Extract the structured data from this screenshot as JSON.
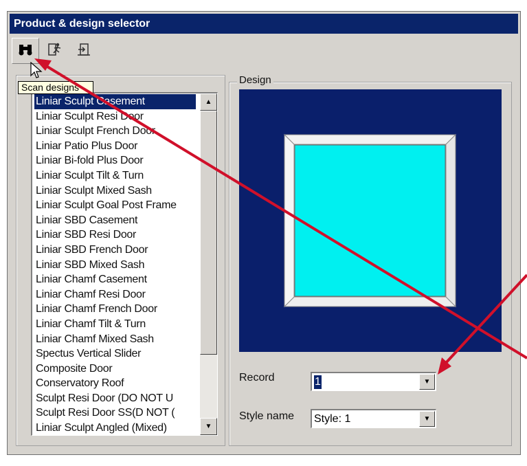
{
  "window": {
    "title": "Product & design selector"
  },
  "toolbar": {
    "buttons": [
      {
        "name": "scan-designs-button",
        "icon": "binoculars-icon"
      },
      {
        "name": "add-design-button",
        "icon": "running-figure-icon"
      },
      {
        "name": "exit-designs-button",
        "icon": "door-exit-icon"
      }
    ],
    "tooltip": "Scan designs"
  },
  "list": {
    "items": [
      "Liniar Sculpt Casement",
      "Liniar Sculpt Resi Door",
      "Liniar Sculpt French Door",
      "Liniar Patio Plus Door",
      "Liniar Bi-fold Plus Door",
      "Liniar Sculpt Tilt & Turn",
      "Liniar Sculpt Mixed Sash",
      "Liniar Sculpt Goal Post Frame",
      "Liniar SBD Casement",
      "Liniar SBD Resi Door",
      "Liniar SBD French Door",
      "Liniar SBD Mixed Sash",
      "Liniar Chamf Casement",
      "Liniar Chamf Resi Door",
      "Liniar Chamf French Door",
      "Liniar Chamf Tilt & Turn",
      "Liniar Chamf Mixed Sash",
      "Spectus Vertical Slider",
      "Composite Door",
      "Conservatory Roof",
      "Sculpt Resi Door (DO NOT U",
      "Sculpt Resi Door SS(D NOT (",
      "Liniar Sculpt Angled (Mixed)"
    ],
    "selected_index": 0
  },
  "design": {
    "label": "Design",
    "background": "#0a1f6b",
    "glass_color": "#00f0f0"
  },
  "form": {
    "record_label": "Record",
    "record_value": "1",
    "style_label": "Style name",
    "style_value": "Style: 1"
  },
  "annotation": {
    "arrow_color": "#d0102a"
  }
}
